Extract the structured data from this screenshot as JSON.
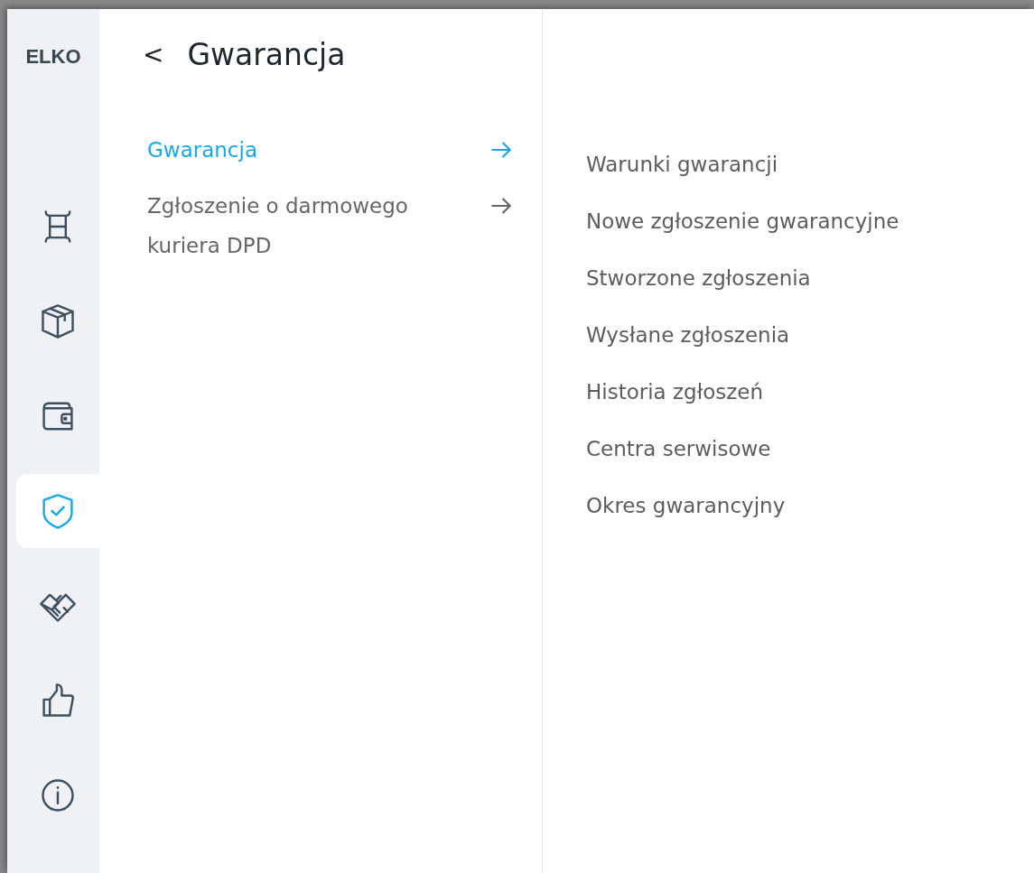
{
  "logo": "ELKO",
  "sidebar": {
    "items": [
      {
        "kind": "shelf",
        "selected": false
      },
      {
        "kind": "box",
        "selected": false
      },
      {
        "kind": "wallet",
        "selected": false
      },
      {
        "kind": "shield",
        "selected": true
      },
      {
        "kind": "handshake",
        "selected": false
      },
      {
        "kind": "thumb",
        "selected": false
      },
      {
        "kind": "info",
        "selected": false
      }
    ]
  },
  "header": {
    "back": "<",
    "title": "Gwarancja"
  },
  "menu": [
    {
      "label": "Gwarancja",
      "selected": true
    },
    {
      "label": "Zgłoszenie o darmowego kuriera DPD",
      "selected": false
    }
  ],
  "submenu": [
    "Warunki gwarancji",
    "Nowe zgłoszenie gwarancyjne",
    "Stworzone zgłoszenia",
    "Wysłane zgłoszenia",
    "Historia zgłoszeń",
    "Centra serwisowe",
    "Okres gwarancyjny"
  ]
}
